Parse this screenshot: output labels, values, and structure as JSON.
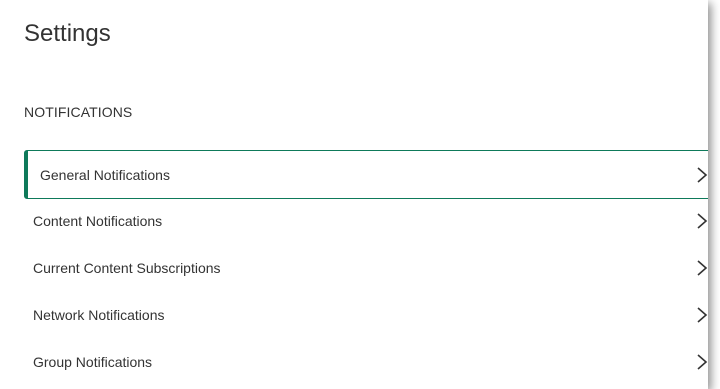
{
  "header": {
    "title": "Settings"
  },
  "notifications": {
    "section_label": "NOTIFICATIONS",
    "items": [
      {
        "label": "General Notifications",
        "icon": "chevron-right-icon",
        "selected": true
      },
      {
        "label": "Content Notifications",
        "icon": "chevron-right-icon",
        "selected": false
      },
      {
        "label": "Current Content Subscriptions",
        "icon": "chevron-right-icon",
        "selected": false
      },
      {
        "label": "Network Notifications",
        "icon": "chevron-right-icon",
        "selected": false
      },
      {
        "label": "Group Notifications",
        "icon": "chevron-right-icon",
        "selected": false
      }
    ]
  },
  "colors": {
    "accent": "#0e7a5a",
    "text": "#333333",
    "background": "#ffffff"
  }
}
